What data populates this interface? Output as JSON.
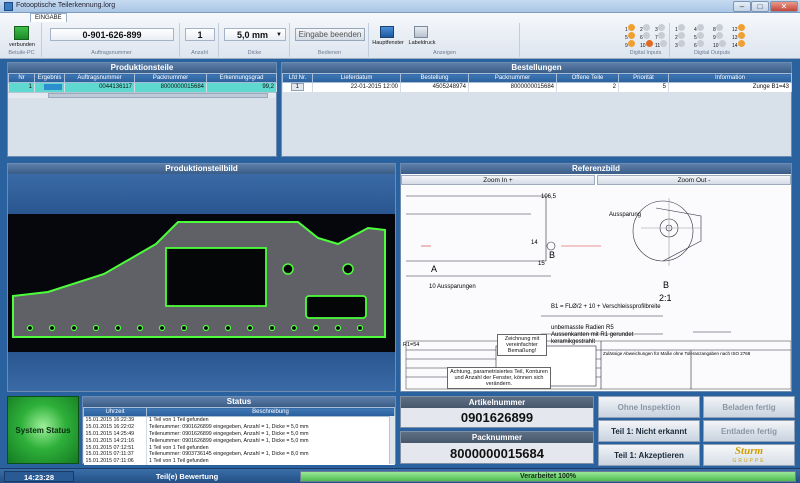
{
  "window": {
    "title": "Fotooptische Teilerkennung.lorg"
  },
  "ribbon": {
    "tab": "EINGABE",
    "connection": {
      "label": "verbunden",
      "group": "Betuile-PC"
    },
    "order_number": {
      "value": "0-901-626-899",
      "group": "Auftragsnummer"
    },
    "quantity": {
      "value": "1",
      "group": "Anzahl"
    },
    "thickness": {
      "value": "5,0 mm",
      "group": "Dicke"
    },
    "finish_input": {
      "label": "Eingabe beenden",
      "group": "Bedienen"
    },
    "main_window": {
      "label": "Hauptfenster"
    },
    "label_print": {
      "label": "Labeldruck"
    },
    "display_group": "Anzeigen",
    "digital_inputs_label": "Digital Inputs",
    "digital_outputs_label": "Digital Outputs",
    "inputs": [
      {
        "n": "1",
        "color": "#f0a030"
      },
      {
        "n": "2",
        "color": "#c8ccd4"
      },
      {
        "n": "3",
        "color": "#c8ccd4"
      },
      {
        "n": "5",
        "color": "#f0a030"
      },
      {
        "n": "6",
        "color": "#c8ccd4"
      },
      {
        "n": "7",
        "color": "#c8ccd4"
      },
      {
        "n": "9",
        "color": "#f0a030"
      },
      {
        "n": "10",
        "color": "#e06a20"
      },
      {
        "n": "11",
        "color": "#c8ccd4"
      }
    ],
    "outputs": [
      {
        "n": "1",
        "color": "#c8ccd4"
      },
      {
        "n": "4",
        "color": "#c8ccd4"
      },
      {
        "n": "8",
        "color": "#c8ccd4"
      },
      {
        "n": "12",
        "color": "#f0a030"
      },
      {
        "n": "2",
        "color": "#c8ccd4"
      },
      {
        "n": "5",
        "color": "#c8ccd4"
      },
      {
        "n": "9",
        "color": "#c8ccd4"
      },
      {
        "n": "13",
        "color": "#f0a030"
      },
      {
        "n": "3",
        "color": "#c8ccd4"
      },
      {
        "n": "6",
        "color": "#c8ccd4"
      },
      {
        "n": "10",
        "color": "#c8ccd4"
      },
      {
        "n": "14",
        "color": "#f0a030"
      }
    ]
  },
  "production_parts": {
    "title": "Produktionsteile",
    "columns": [
      "Nr",
      "Ergebnis",
      "Auftragsnummer",
      "Packnummer",
      "Erkennungsgrad"
    ],
    "rows": [
      {
        "nr": "1",
        "result": "",
        "order": "0044136117",
        "pack": "8000000015684",
        "rate": "99,2"
      }
    ]
  },
  "orders": {
    "title": "Bestellungen",
    "columns": [
      "Lfd Nr.",
      "Lieferdatum",
      "Bestellung",
      "Packnummer",
      "Offene Teile",
      "Priorität",
      "Information"
    ],
    "rows": [
      {
        "nr": "1",
        "date": "22-01-2015 12:00",
        "order": "4505248974",
        "pack": "8000000015684",
        "open": "2",
        "prio": "5",
        "info": "Zunge B1=43"
      }
    ]
  },
  "part_image": {
    "title": "Produktionsteilbild"
  },
  "reference": {
    "title": "Referenzbild",
    "zoom_in": "Zoom In +",
    "zoom_out": "Zoom Out -",
    "dim_106": "106,5",
    "dim_14": "14",
    "dim_15": "15",
    "label_A": "A",
    "label_B": "B",
    "detail_B": "B",
    "detail_scale": "2:1",
    "long_holes": "10 Aussparungen",
    "aussparung": "Aussparung",
    "note1": "B1 = FLØ/2 + 10 + Verschleissprofilbreite",
    "note2": "unbemasste Radien R5",
    "note3": "Aussenkanten mit R1 gerundet",
    "note4": "keramikgestrahlt",
    "drawing_note": "Zeichnung mit vereinfachter Bemaßung!",
    "warning": "Achtung, parametrisiertes Teil, Konturen und Anzahl der Fenster, können sich verändern.",
    "tol_title": "Zulässige Abweichungen für Maße ohne Toleranzangaben nach ISO 2768",
    "radius_note": "R1=54"
  },
  "system_status": {
    "label": "System Status",
    "color": "#2eb03a"
  },
  "status": {
    "title": "Status",
    "columns": [
      "Uhrzeit",
      "Beschreibung"
    ],
    "rows": [
      {
        "time": "15.01.2015 16:22:39",
        "desc": "1 Teil von 1 Teil gefunden"
      },
      {
        "time": "15.01.2015 16:22:02",
        "desc": "Teilenummer: 0901626899 eingegeben, Anzahl = 1, Dicke = 5,0 mm"
      },
      {
        "time": "15.01.2015 14:25:49",
        "desc": "Teilenummer: 0901626899 eingegeben, Anzahl = 1, Dicke = 5,0 mm"
      },
      {
        "time": "15.01.2015 14:21:16",
        "desc": "Teilenummer: 0901626899 eingegeben, Anzahl = 1, Dicke = 5,0 mm"
      },
      {
        "time": "15.01.2015 07:12:51",
        "desc": "1 Teil von 1 Teil gefunden"
      },
      {
        "time": "15.01.2015 07:11:37",
        "desc": "Teilenummer: 0903736145 eingegeben, Anzahl = 1, Dicke = 8,0 mm"
      },
      {
        "time": "15.01.2015 07:11:06",
        "desc": "1 Teil von 1 Teil gefunden"
      }
    ]
  },
  "article": {
    "title": "Artikelnummer",
    "value": "0901626899"
  },
  "pack": {
    "title": "Packnummer",
    "value": "8000000015684"
  },
  "buttons": {
    "no_inspection": "Ohne Inspektion",
    "loading_done": "Beladen fertig",
    "part_not_recognized": "Teil 1: Nicht erkannt",
    "unloading_done": "Entladen fertig",
    "part_accept": "Teil 1: Akzeptieren"
  },
  "logo": {
    "name": "Sturm",
    "sub": "GRUPPE"
  },
  "statusbar": {
    "time": "14:23:28",
    "evaluation": "Teil(e) Bewertung",
    "progress_label": "Verarbeitet 100%",
    "progress": 1.0
  }
}
